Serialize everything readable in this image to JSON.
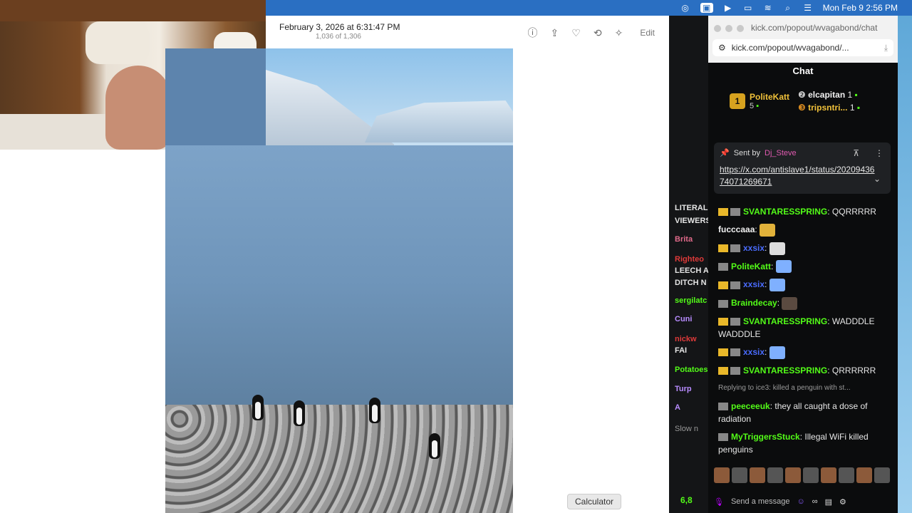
{
  "menubar": {
    "datetime": "Mon Feb 9  2:56 PM",
    "icons": [
      "creative-cloud-icon",
      "screen-share-icon",
      "play-icon",
      "battery-icon",
      "wifi-icon",
      "search-icon",
      "control-center-icon"
    ]
  },
  "photos": {
    "title": "February 3, 2026 at 6:31:47 PM",
    "count": "1,036 of 1,306",
    "edit_label": "Edit"
  },
  "browser": {
    "tab_title": "kick.com/popout/wvagabond/chat",
    "url": "kick.com/popout/wvagabond/..."
  },
  "chat": {
    "header": "Chat",
    "leaders": [
      {
        "rank": "1",
        "name": "PoliteKatt",
        "count": "5"
      },
      {
        "rank": "",
        "name": "elcapitan",
        "count": "1"
      },
      {
        "rank": "",
        "name": "tripsntri...",
        "count": "1"
      }
    ],
    "pinned": {
      "sent_by": "Sent by",
      "sender": "Dj_Steve",
      "link": "https://x.com/antislave1/status/2020943674071269671"
    },
    "messages": [
      {
        "user": "SVANTARESSPRING",
        "text": ": QQRRRRR",
        "color": "green"
      },
      {
        "user": "fucccaaa",
        "text": ":",
        "color": "white"
      },
      {
        "user": "xxsix",
        "text": ":",
        "color": "blue"
      },
      {
        "user": "PoliteKatt",
        "text": ":",
        "color": "green"
      },
      {
        "user": "xxsix",
        "text": ":",
        "color": "blue"
      },
      {
        "user": "Braindecay",
        "text": ":",
        "color": "green"
      },
      {
        "user": "SVANTARESSPRING",
        "text": ": WADDDLE WADDDLE",
        "color": "green"
      },
      {
        "user": "xxsix",
        "text": ":",
        "color": "blue"
      },
      {
        "user": "SVANTARESSPRING",
        "text": ": QRRRRRR",
        "color": "green"
      },
      {
        "reply": "Replying to ice3: killed a penguin with st..."
      },
      {
        "user": "peeceeuk",
        "text": ": they all caught a dose of radiation",
        "color": "green"
      },
      {
        "user": "MyTriggersStuck",
        "text": ": Illegal WiFi killed penguins",
        "color": "green"
      }
    ],
    "composer_placeholder": "Send a message",
    "viewer_count": "6,8"
  },
  "left_strip": [
    "LITERAL",
    "VIEWERS",
    "Brita",
    "Righteo",
    "LEECH A",
    "DITCH N",
    "sergilatc",
    "Cuni",
    "nickw",
    "FAI",
    "Potatoes",
    "Turp",
    "A",
    "Slow n"
  ],
  "tooltip": "Calculator"
}
